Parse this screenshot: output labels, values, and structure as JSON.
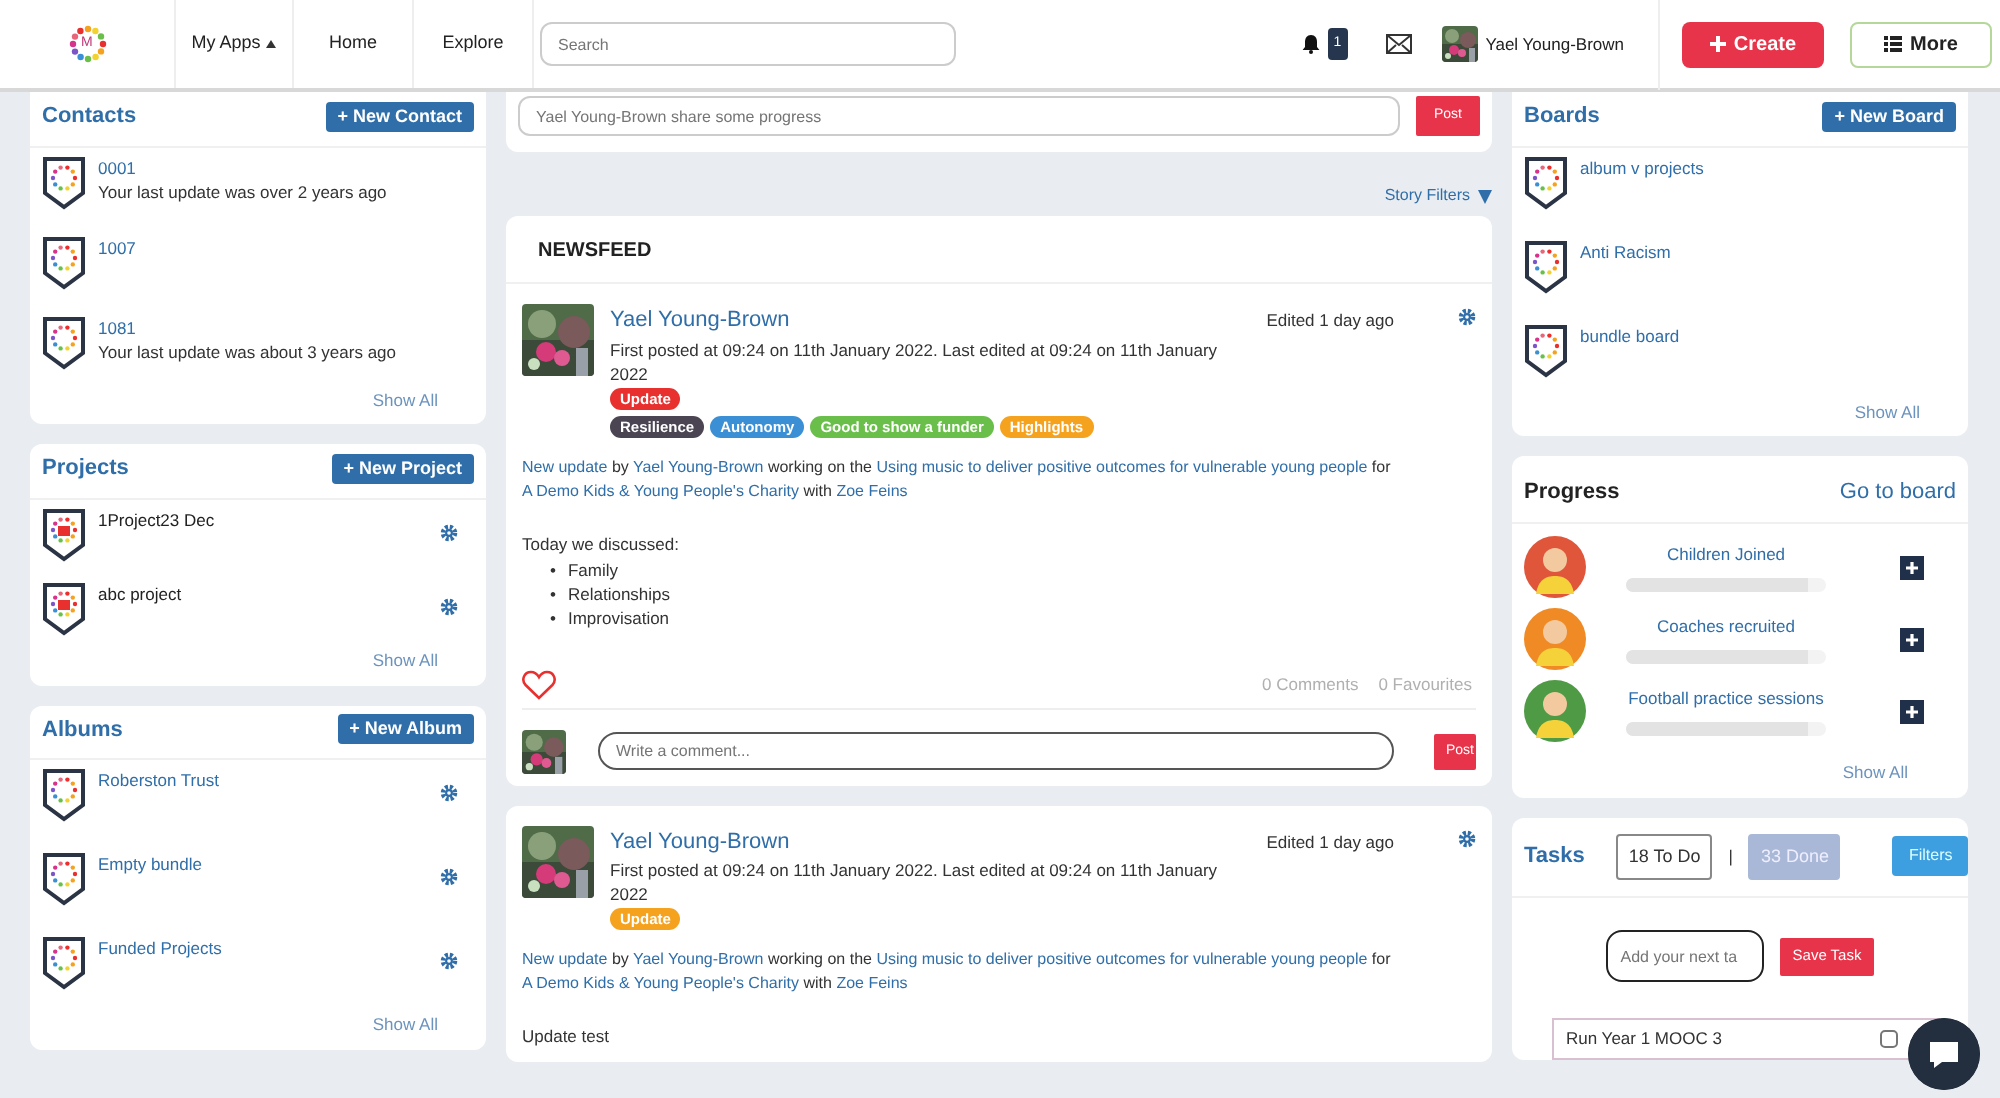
{
  "nav": {
    "logo_text": "M",
    "apps": "My Apps",
    "home": "Home",
    "explore": "Explore",
    "search_placeholder": "Search",
    "notification_count": "1",
    "user_name": "Yael Young-Brown",
    "create": "Create",
    "more": "More"
  },
  "contacts": {
    "title": "Contacts",
    "button": "+ New Contact",
    "items": [
      {
        "name": "0001",
        "subtitle": "Your last update was over 2 years ago"
      },
      {
        "name": "1007"
      },
      {
        "name": "1081",
        "subtitle": "Your last update was about 3 years ago"
      }
    ],
    "show_all": "Show All"
  },
  "projects": {
    "title": "Projects",
    "button": "+ New Project",
    "items": [
      {
        "name": "1Project23 Dec"
      },
      {
        "name": "abc project"
      }
    ],
    "show_all": "Show All"
  },
  "albums": {
    "title": "Albums",
    "button": "+ New Album",
    "items": [
      {
        "name": "Roberston Trust"
      },
      {
        "name": "Empty bundle"
      },
      {
        "name": "Funded Projects"
      }
    ],
    "show_all": "Show All"
  },
  "share": {
    "placeholder": "Yael Young-Brown share some progress",
    "post": "Post"
  },
  "story_filters": "Story Filters",
  "newsfeed": {
    "title": "NEWSFEED",
    "posts": [
      {
        "author": "Yael Young-Brown",
        "edited": "Edited 1 day ago",
        "meta": "First posted at 09:24 on 11th January 2022. Last edited at 09:24 on 11th January 2022",
        "category": {
          "label": "Update",
          "color": "#e8312f"
        },
        "tags": [
          {
            "label": "Resilience",
            "color": "#4b4453"
          },
          {
            "label": "Autonomy",
            "color": "#3b8fd4"
          },
          {
            "label": "Good to show a funder",
            "color": "#6abf4b"
          },
          {
            "label": "Highlights",
            "color": "#f5a21f"
          }
        ],
        "sentence": [
          {
            "text": "New update",
            "link": true
          },
          {
            "text": "by",
            "link": false
          },
          {
            "text": "Yael Young-Brown",
            "link": true
          },
          {
            "text": "working on the",
            "link": false
          },
          {
            "text": "Using music to deliver positive outcomes for vulnerable young people",
            "link": true
          },
          {
            "text": "for",
            "link": false
          },
          {
            "text": "A Demo Kids & Young People's Charity",
            "link": true
          },
          {
            "text": "with",
            "link": false
          },
          {
            "text": "Zoe Feins",
            "link": true
          }
        ],
        "intro": "Today we discussed:",
        "bullet": "•",
        "bullets": [
          "Family",
          "Relationships",
          "Improvisation"
        ],
        "comments": "0 Comments",
        "favourites": "0 Favourites",
        "comment_placeholder": "Write a comment...",
        "post": "Post"
      },
      {
        "author": "Yael Young-Brown",
        "edited": "Edited 1 day ago",
        "meta": "First posted at 09:24 on 11th January 2022. Last edited at 09:24 on 11th January 2022",
        "category": {
          "label": "Update",
          "color": "#f5a21f"
        },
        "sentence": [
          {
            "text": "New update",
            "link": true
          },
          {
            "text": "by",
            "link": false
          },
          {
            "text": "Yael Young-Brown",
            "link": true
          },
          {
            "text": "working on the",
            "link": false
          },
          {
            "text": "Using music to deliver positive outcomes for vulnerable young people",
            "link": true
          },
          {
            "text": "for",
            "link": false
          },
          {
            "text": "A Demo Kids & Young People's Charity",
            "link": true
          },
          {
            "text": "with",
            "link": false
          },
          {
            "text": "Zoe Feins",
            "link": true
          }
        ],
        "intro": "Update test"
      }
    ]
  },
  "boards": {
    "title": "Boards",
    "button": "+ New Board",
    "items": [
      {
        "name": "album v projects"
      },
      {
        "name": "Anti Racism"
      },
      {
        "name": "bundle board"
      }
    ],
    "show_all": "Show All"
  },
  "progress": {
    "title": "Progress",
    "link": "Go to board",
    "items": [
      {
        "label": "Children Joined",
        "level": 0.91
      },
      {
        "label": "Coaches recruited",
        "level": 0.91
      },
      {
        "label": "Football practice sessions",
        "level": 0.91
      }
    ],
    "show_all": "Show All"
  },
  "tasks": {
    "title": "Tasks",
    "tabs": [
      {
        "label": "18 To Do",
        "selected": true
      },
      {
        "label": "33 Done",
        "selected": false
      }
    ],
    "separator": "|",
    "filters": "Filters",
    "add_placeholder": "Add your next ta",
    "save": "Save Task",
    "items": [
      {
        "label": "Run Year 1 MOOC 3",
        "checked": false
      }
    ]
  }
}
